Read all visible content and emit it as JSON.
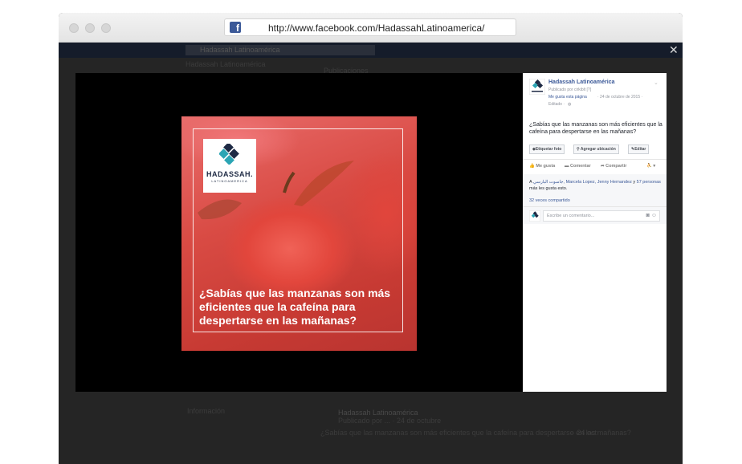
{
  "browser": {
    "url": "http://www.facebook.com/HadassahLatinoamerica/",
    "favicon_letter": "f"
  },
  "background_page": {
    "search_text": "Hadassah Latinoamérica",
    "left_text": "Hadassah Latinoamérica",
    "top_text": "Publicaciones",
    "post_author": "Hadassah Latinoamérica",
    "post_meta": "Publicado por ... · 24 de octubre",
    "post_text": "¿Sabías que las manzanas son más eficientes que la cafeína para despertarse en las mañanas?",
    "post_date": "· 24 oct",
    "left_footer": "Información"
  },
  "photo": {
    "logo_word": "HADASSAH.",
    "logo_sub": "LATINOAMERICA",
    "caption": "¿Sabías que las manzanas son más eficientes que la cafeína para despertarse en las mañanas?"
  },
  "panel": {
    "author": "Hadassah Latinoamérica",
    "published_by": "Publicado por cirkiblt [?]",
    "like_page": "Me gusta esta página",
    "date": "· 24 de octubre de 2015 ·",
    "edited": "Editado · ",
    "post_text": "¿Sabías que las manzanas son más eficientes que la cafeína para despertarse en las mañanas?",
    "actions": [
      "Etiquetar foto",
      "Agregar ubicación",
      "Editar"
    ],
    "links": [
      "Me gusta",
      "Comentar",
      "Compartir"
    ],
    "likes_prefix": "A ",
    "likes_names": "جاسوت البارسي, Marcela Lopez, Jenny Hernandez",
    "likes_and": " y ",
    "likes_others": "57 personas",
    "likes_suffix": " más les gusta esto.",
    "shares": "32 veces compartido",
    "comment_placeholder": "Escribe un comentario..."
  },
  "colors": {
    "facebook_blue": "#3b5998",
    "logo_dark": "#1e2a44",
    "logo_teal": "#2ba5b4"
  },
  "icons": {
    "close": "close-icon",
    "logo": "hadassah-logo-icon"
  }
}
